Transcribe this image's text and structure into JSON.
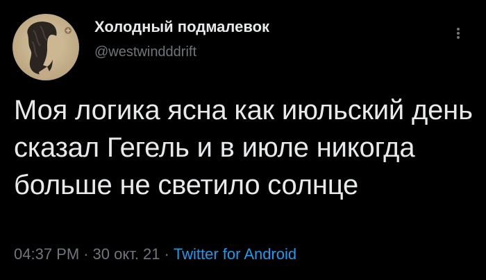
{
  "author": {
    "display_name": "Холодный подмалевок",
    "handle": "@westwindddrift",
    "avatar_icon": "portrait-avatar-icon"
  },
  "menu": {
    "icon": "more-vertical-icon"
  },
  "tweet": {
    "text": "Моя логика ясна как июльский день сказал Гегель и в июле никогда больше не светило солнце"
  },
  "meta": {
    "time": "04:37 PM",
    "separator": "·",
    "date": "30 окт. 21",
    "source": "Twitter for Android"
  },
  "colors": {
    "background": "#000000",
    "primary_text": "#e7e9ea",
    "secondary_text": "#71767b",
    "link": "#1d9bf0"
  }
}
